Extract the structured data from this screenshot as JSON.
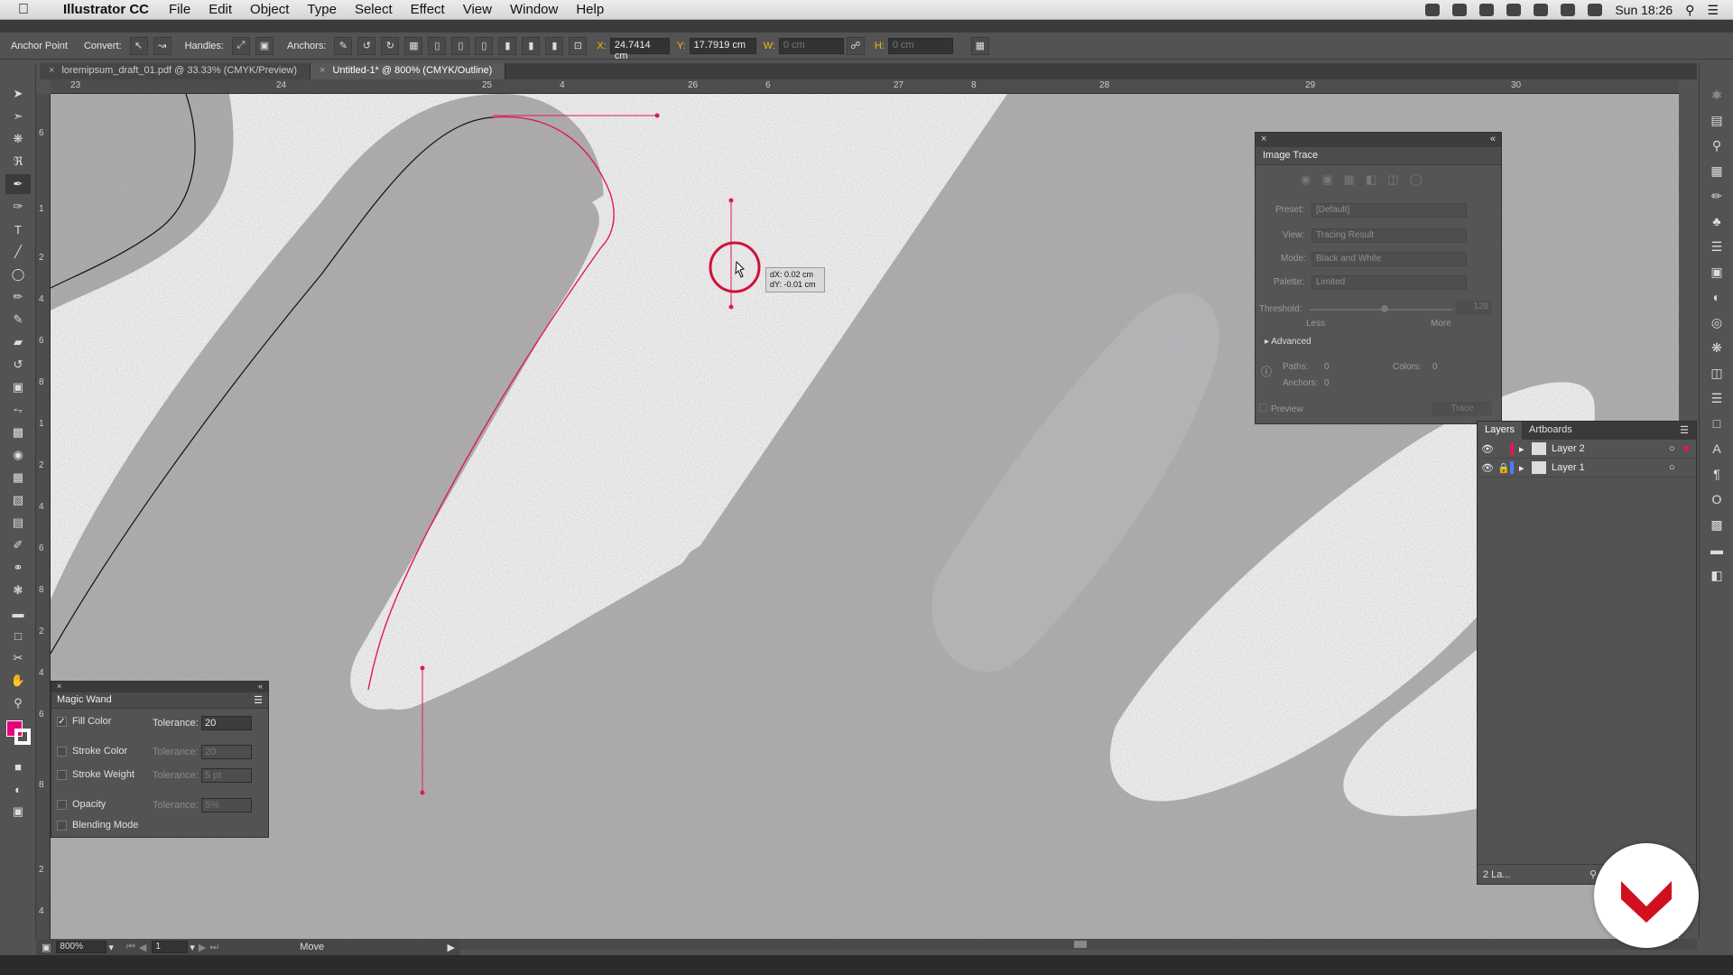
{
  "menubar": {
    "app_name": "Illustrator CC",
    "items": [
      "File",
      "Edit",
      "Object",
      "Type",
      "Select",
      "Effect",
      "View",
      "Window",
      "Help"
    ],
    "clock": "Sun 18:26"
  },
  "controlbar": {
    "anchor_point": "Anchor Point",
    "convert": "Convert:",
    "handles": "Handles:",
    "anchors": "Anchors:",
    "x_label": "X:",
    "x_value": "24.7414 cm",
    "y_label": "Y:",
    "y_value": "17.7919 cm",
    "w_label": "W:",
    "w_value": "0 cm",
    "h_label": "H:",
    "h_value": "0 cm"
  },
  "tabs": [
    {
      "label": "loremipsum_draft_01.pdf @ 33.33% (CMYK/Preview)"
    },
    {
      "label": "Untitled-1* @ 800% (CMYK/Outline)"
    }
  ],
  "ruler_top": [
    "23",
    "24",
    "25",
    "4",
    "26",
    "6",
    "27",
    "8",
    "28",
    "29",
    "30"
  ],
  "ruler_left": [
    "6",
    "1",
    "2",
    "4",
    "6",
    "8",
    "1",
    "2",
    "4",
    "6",
    "8",
    "2",
    "4",
    "6",
    "8",
    "2",
    "4"
  ],
  "image_trace": {
    "title": "Image Trace",
    "preset_label": "Preset:",
    "preset_value": "[Default]",
    "view_label": "View:",
    "view_value": "Tracing Result",
    "mode_label": "Mode:",
    "mode_value": "Black and White",
    "palette_label": "Palette:",
    "palette_value": "Limited",
    "threshold_label": "Threshold:",
    "threshold_value": "128",
    "threshold_level": 0.5,
    "less": "Less",
    "more": "More",
    "advanced": "Advanced",
    "paths_label": "Paths:",
    "paths_value": "0",
    "anchors_label": "Anchors:",
    "anchors_value": "0",
    "colors_label": "Colors:",
    "colors_value": "0",
    "preview": "Preview",
    "trace_button": "Trace"
  },
  "layers": {
    "tab_layers": "Layers",
    "tab_artboards": "Artboards",
    "items": [
      {
        "name": "Layer 2",
        "color": "#e0195a",
        "locked": false
      },
      {
        "name": "Layer 1",
        "color": "#4a7bff",
        "locked": true
      }
    ],
    "footer": "2 La..."
  },
  "magic_wand": {
    "title": "Magic Wand",
    "rows": [
      {
        "label": "Fill Color",
        "checked": true,
        "tol_label": "Tolerance:",
        "tol_value": "20"
      },
      {
        "label": "Stroke Color",
        "checked": false,
        "tol_label": "Tolerance:",
        "tol_value": "20"
      },
      {
        "label": "Stroke Weight",
        "checked": false,
        "tol_label": "Tolerance:",
        "tol_value": "5 pt"
      },
      {
        "label": "Opacity",
        "checked": false,
        "tol_label": "Tolerance:",
        "tol_value": "5%"
      },
      {
        "label": "Blending Mode",
        "checked": false
      }
    ]
  },
  "tooltip": {
    "dx": "dX: 0.02 cm",
    "dy": "dY: -0.01 cm"
  },
  "statusbar": {
    "zoom": "800%",
    "artboard": "1",
    "tool": "Move"
  },
  "colors": {
    "path_red": "#e0195a",
    "fill_swatch": "#e6007e",
    "accent_yellow": "#e8c000"
  }
}
